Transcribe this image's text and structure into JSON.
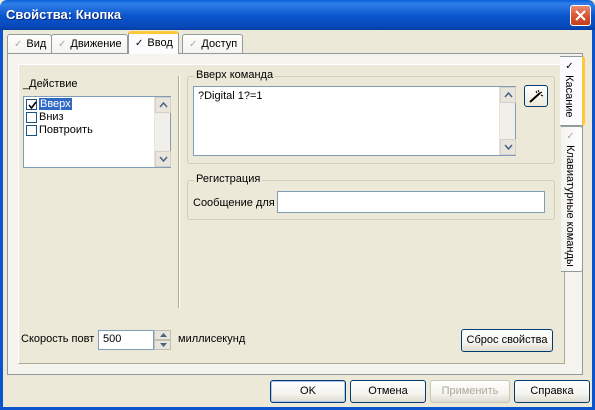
{
  "window": {
    "title": "Свойства: Кнопка"
  },
  "tabs": [
    {
      "label": "Вид",
      "active": false
    },
    {
      "label": "Движение",
      "active": false
    },
    {
      "label": "Ввод",
      "active": true
    },
    {
      "label": "Доступ",
      "active": false
    }
  ],
  "side_tabs": [
    {
      "label": "Касание",
      "active": true
    },
    {
      "label": "Клавиатурные команды",
      "active": false
    }
  ],
  "action": {
    "title": "_Действие",
    "items": [
      {
        "label": "Вверх",
        "checked": true,
        "selected": true
      },
      {
        "label": "Вниз",
        "checked": false,
        "selected": false
      },
      {
        "label": "Повтроить",
        "checked": false,
        "selected": false
      }
    ]
  },
  "up_command": {
    "title": "Вверх команда",
    "value": "?Digital 1?=1"
  },
  "registration": {
    "title": "Регистрация",
    "message_label": "Сообщение для",
    "message_value": ""
  },
  "repeat": {
    "label": "Скорость повт",
    "value": "500",
    "unit": "миллисекунд"
  },
  "buttons": {
    "reset": "Сброс свойства",
    "ok": "OK",
    "cancel": "Отмена",
    "apply": "Применить",
    "help": "Справка"
  },
  "colors": {
    "titlebar": "#0a54cc",
    "accent_tab": "#ffc83c",
    "selection": "#316ac5"
  }
}
